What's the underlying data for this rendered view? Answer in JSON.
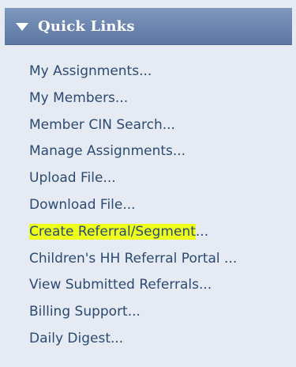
{
  "quick_links": {
    "title": "Quick Links",
    "collapse_icon": "triangle-down-icon",
    "highlight_color": "#eeff1a",
    "items": [
      {
        "label": "My Assignments..."
      },
      {
        "label": "My Members..."
      },
      {
        "label": "Member CIN Search..."
      },
      {
        "label": "Manage Assignments..."
      },
      {
        "label": "Upload File..."
      },
      {
        "label": "Download File..."
      },
      {
        "label_highlighted": "Create Referral/Segment",
        "label_rest": "..."
      },
      {
        "label": "Children's HH Referral Portal ..."
      },
      {
        "label": "View Submitted Referrals..."
      },
      {
        "label": "Billing Support..."
      },
      {
        "label": "Daily Digest..."
      }
    ]
  }
}
